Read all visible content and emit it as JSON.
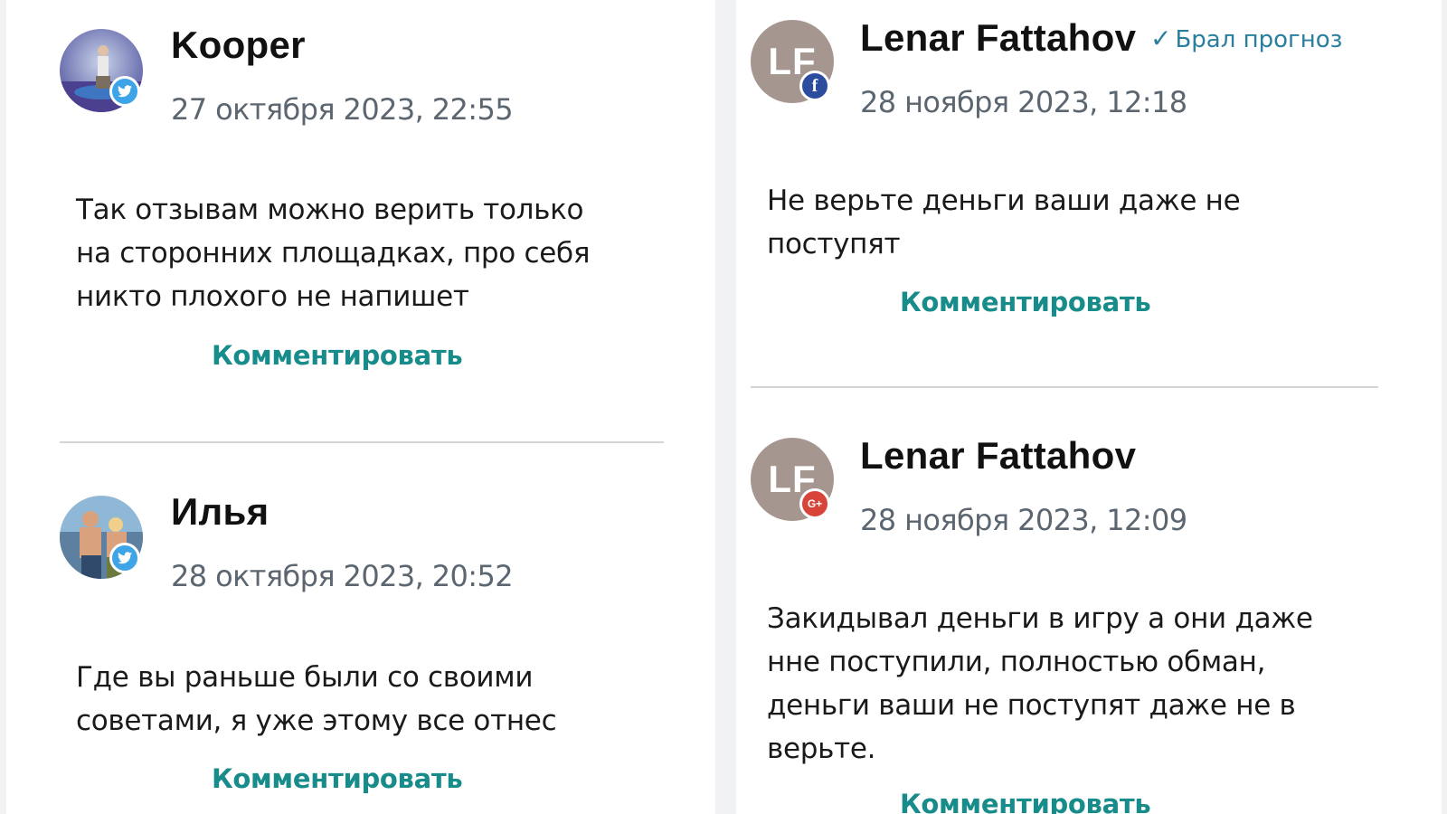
{
  "comments_left": [
    {
      "author": "Kooper",
      "date": "27 октября 2023, 22:55",
      "social": "twitter-icon",
      "text_lines": [
        "Так отзывам можно верить только",
        "на сторонних площадках, про себя",
        "никто плохого не напишет"
      ],
      "reply_label": "Комментировать"
    },
    {
      "author": "Илья",
      "date": "28 октября 2023, 20:52",
      "social": "twitter-icon",
      "text_lines": [
        "Где вы раньше были со своими",
        "советами, я уже этому все отнес"
      ],
      "reply_label": "Комментировать"
    }
  ],
  "comments_right": [
    {
      "author": "Lenar Fattahov",
      "avatar_initials": "LF",
      "verified_label": "Брал прогноз",
      "date": "28 ноября 2023, 12:18",
      "social": "facebook-icon",
      "text_lines": [
        "Не верьте деньги ваши даже не",
        "поступят"
      ],
      "reply_label": "Комментировать"
    },
    {
      "author": "Lenar Fattahov",
      "avatar_initials": "LF",
      "date": "28 ноября 2023, 12:09",
      "social": "google-plus-icon",
      "text_lines": [
        "Закидывал деньги в игру а они даже",
        "нне поступили, полностью обман,",
        "деньги ваши не поступят даже не в",
        "верьте."
      ],
      "reply_label": "Комментировать"
    }
  ],
  "colors": {
    "accent_link": "#178c8a",
    "verified": "#2a7f9e",
    "date_text": "#5c6670",
    "twitter": "#3ea4e8",
    "facebook": "#2c4d9e",
    "google_plus": "#d8443a",
    "avatar_initials_bg": "#a5968f"
  }
}
